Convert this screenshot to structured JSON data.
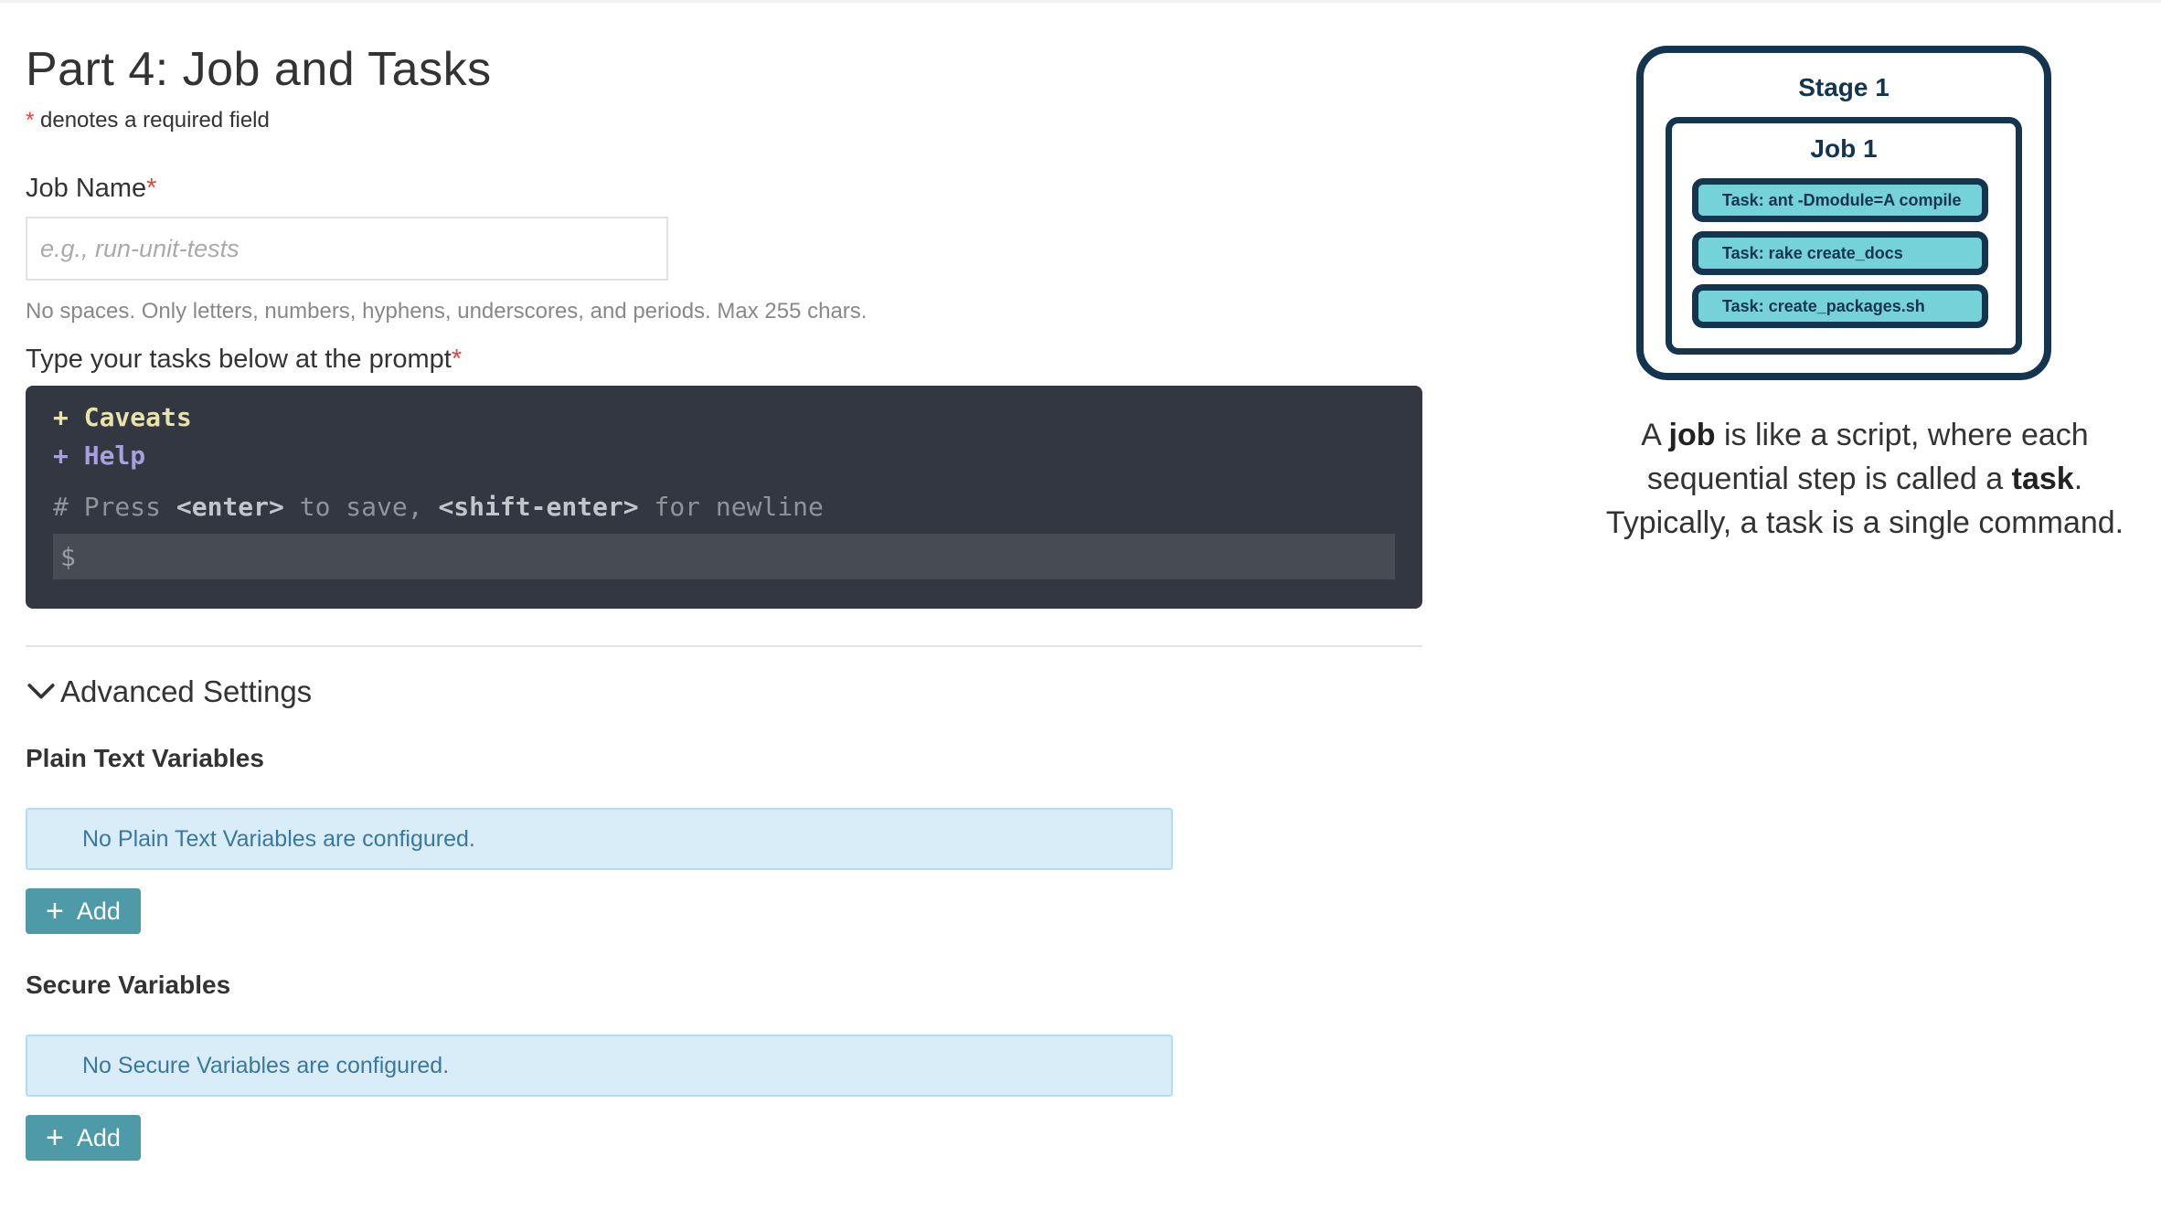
{
  "page": {
    "title": "Part 4: Job and Tasks",
    "required_note_star": "*",
    "required_note": " denotes a required field"
  },
  "job_name": {
    "label": "Job Name",
    "required_star": "*",
    "placeholder": "e.g., run-unit-tests",
    "value": "",
    "hint": "No spaces. Only letters, numbers, hyphens, underscores, and periods. Max 255 chars."
  },
  "tasks": {
    "label": "Type your tasks below at the prompt",
    "required_star": "*",
    "caveats": "+ Caveats",
    "help": "+ Help",
    "comment_prefix": "# Press ",
    "comment_enter": "<enter>",
    "comment_mid": " to save, ",
    "comment_shift_enter": "<shift-enter>",
    "comment_suffix": " for newline",
    "prompt_symbol": "$",
    "prompt_value": ""
  },
  "advanced": {
    "toggle_label": "Advanced Settings",
    "plain_text": {
      "title": "Plain Text Variables",
      "empty_message": "No Plain Text Variables are configured.",
      "add_label": "Add"
    },
    "secure": {
      "title": "Secure Variables",
      "empty_message": "No Secure Variables are configured.",
      "add_label": "Add"
    }
  },
  "diagram": {
    "stage_label": "Stage 1",
    "job_label": "Job 1",
    "tasks": [
      "Task: ant -Dmodule=A compile",
      "Task: rake create_docs",
      "Task: create_packages.sh"
    ],
    "caption": {
      "p1": "A ",
      "job_word": "job",
      "p2": " is like a script, where each sequential step is called a ",
      "task_word": "task",
      "p3": ". Typically, a task is a single command."
    }
  },
  "colors": {
    "required_star": "#e0453f",
    "terminal_bg": "#333741",
    "info_box_bg": "#d8edf8",
    "add_button": "#4f9aa8",
    "diagram_border": "#143550",
    "task_fill": "#74d2d8"
  }
}
